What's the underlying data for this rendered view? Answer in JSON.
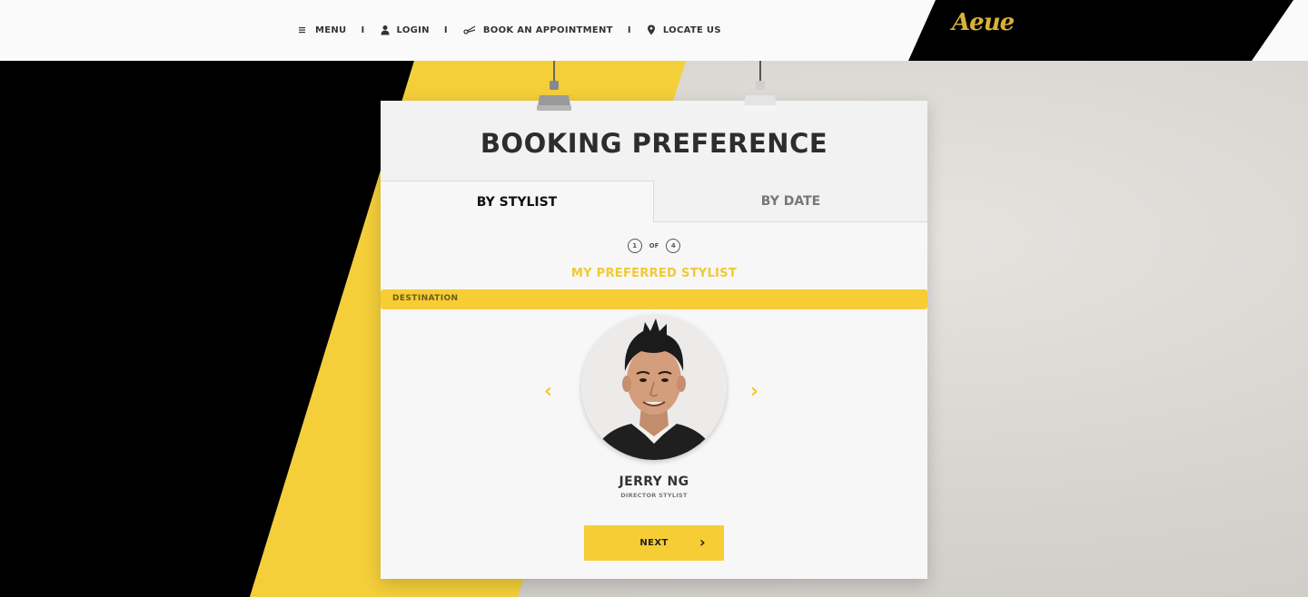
{
  "nav": {
    "menu_label": "MENU",
    "login_label": "LOGIN",
    "book_label": "BOOK AN APPOINTMENT",
    "locate_label": "LOCATE US",
    "separator": "I",
    "icons": [
      "menu-icon",
      "user-icon",
      "scissors-icon",
      "map-pin-icon"
    ]
  },
  "brand": {
    "logo_text": "Aeue",
    "logo_color": "#d9b13a"
  },
  "card": {
    "title": "BOOKING PREFERENCE",
    "tabs": [
      {
        "label": "BY STYLIST",
        "active": true
      },
      {
        "label": "BY DATE",
        "active": false
      }
    ],
    "step": {
      "current": "1",
      "of_label": "OF",
      "total": "4"
    },
    "subtitle": "MY PREFERRED STYLIST",
    "destination_label": "DESTINATION",
    "stylist": {
      "name": "JERRY NG",
      "role": "DIRECTOR STYLIST"
    },
    "prev_arrow": "‹",
    "next_arrow": "›",
    "next_button": "NEXT",
    "next_chevron": "›"
  },
  "colors": {
    "accent_yellow": "#f6cd35",
    "subtitle_yellow": "#f2c934",
    "black": "#000000"
  }
}
